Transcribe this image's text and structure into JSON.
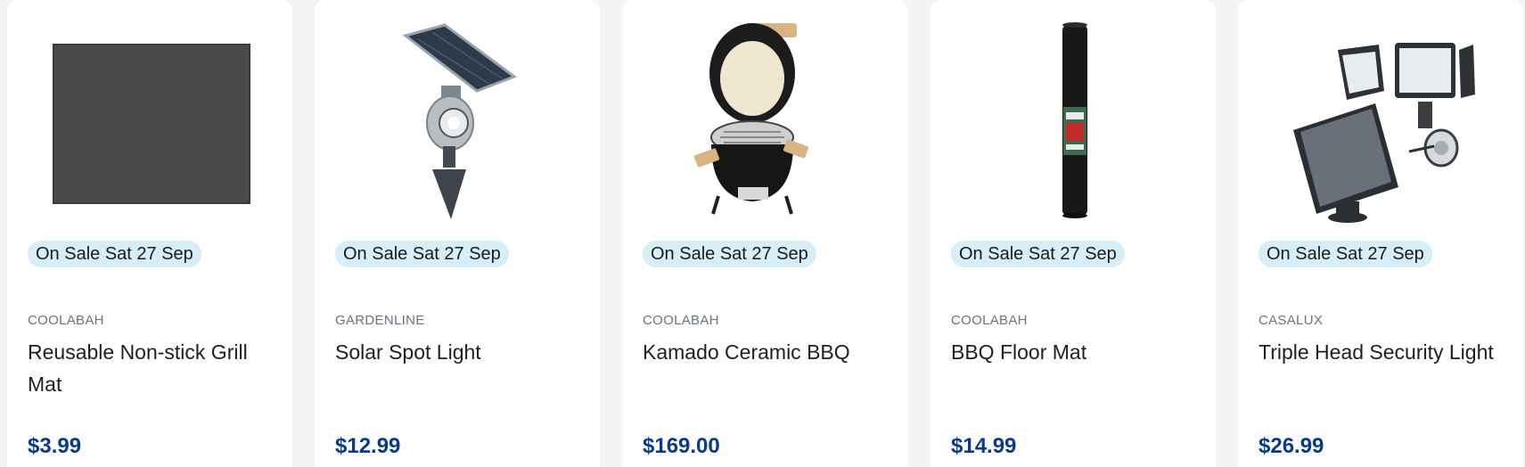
{
  "products": [
    {
      "image_icon": "grill-mat-image",
      "badge": "On Sale Sat 27 Sep",
      "brand": "COOLABAH",
      "title": "Reusable Non-stick Grill Mat",
      "price": "$3.99"
    },
    {
      "image_icon": "solar-spot-light-image",
      "badge": "On Sale Sat 27 Sep",
      "brand": "GARDENLINE",
      "title": "Solar Spot Light",
      "price": "$12.99"
    },
    {
      "image_icon": "kamado-bbq-image",
      "badge": "On Sale Sat 27 Sep",
      "brand": "COOLABAH",
      "title": "Kamado Ceramic BBQ",
      "price": "$169.00"
    },
    {
      "image_icon": "bbq-floor-mat-image",
      "badge": "On Sale Sat 27 Sep",
      "brand": "COOLABAH",
      "title": "BBQ Floor Mat",
      "price": "$14.99"
    },
    {
      "image_icon": "security-light-image",
      "badge": "On Sale Sat 27 Sep",
      "brand": "CASALUX",
      "title": "Triple Head Security Light",
      "price": "$26.99"
    }
  ],
  "colors": {
    "badge_bg": "#d5eef8",
    "price": "#0b3a8c",
    "brand": "#6b7280",
    "page_bg": "#f3f4f6"
  }
}
